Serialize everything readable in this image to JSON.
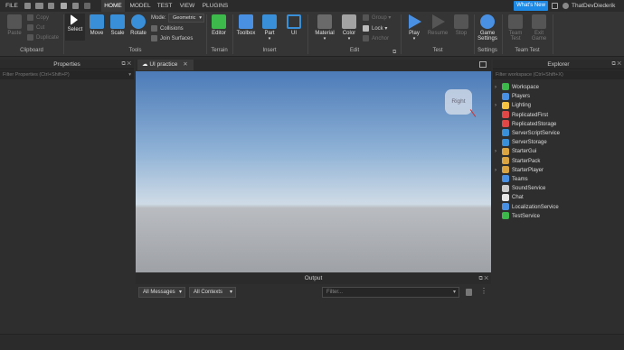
{
  "menu": {
    "file": "FILE",
    "tabs": [
      "HOME",
      "MODEL",
      "TEST",
      "VIEW",
      "PLUGINS"
    ],
    "active_tab": "HOME",
    "whats_new": "What's New",
    "username": "ThatDevDiederik"
  },
  "ribbon": {
    "clipboard": {
      "label": "Clipboard",
      "paste": "Paste",
      "copy": "Copy",
      "cut": "Cut",
      "duplicate": "Duplicate"
    },
    "tools": {
      "label": "Tools",
      "select": "Select",
      "move": "Move",
      "scale": "Scale",
      "rotate": "Rotate",
      "mode_label": "Mode:",
      "mode_value": "Geometric",
      "collisions": "Collisions",
      "join_surfaces": "Join Surfaces"
    },
    "terrain": {
      "label": "Terrain",
      "editor": "Editor"
    },
    "insert": {
      "label": "Insert",
      "toolbox": "Toolbox",
      "part": "Part",
      "ui": "UI"
    },
    "edit": {
      "label": "Edit",
      "material": "Material",
      "color": "Color",
      "group": "Group",
      "lock": "Lock",
      "anchor": "Anchor"
    },
    "test": {
      "label": "Test",
      "play": "Play",
      "resume": "Resume",
      "stop": "Stop"
    },
    "settings": {
      "label": "Settings",
      "game_settings_l1": "Game",
      "game_settings_l2": "Settings"
    },
    "team_test": {
      "label": "Team Test",
      "team_test_l1": "Team",
      "team_test_l2": "Test",
      "exit_game_l1": "Exit",
      "exit_game_l2": "Game"
    }
  },
  "properties": {
    "title": "Properties",
    "filter_placeholder": "Filter Properties (Ctrl+Shift+P)"
  },
  "viewport": {
    "tab": "UI practice",
    "viewcube_label": "Right"
  },
  "explorer": {
    "title": "Explorer",
    "filter_placeholder": "Filter workspace (Ctrl+Shift+X)",
    "items": [
      {
        "name": "Workspace",
        "expandable": true,
        "color": "#3db84a"
      },
      {
        "name": "Players",
        "expandable": false,
        "color": "#4a90e2"
      },
      {
        "name": "Lighting",
        "expandable": true,
        "color": "#f5c242"
      },
      {
        "name": "ReplicatedFirst",
        "expandable": false,
        "color": "#e04848"
      },
      {
        "name": "ReplicatedStorage",
        "expandable": false,
        "color": "#e04848"
      },
      {
        "name": "ServerScriptService",
        "expandable": false,
        "color": "#3a8fd9"
      },
      {
        "name": "ServerStorage",
        "expandable": false,
        "color": "#3a8fd9"
      },
      {
        "name": "StarterGui",
        "expandable": true,
        "color": "#d9a441"
      },
      {
        "name": "StarterPack",
        "expandable": false,
        "color": "#d9a441"
      },
      {
        "name": "StarterPlayer",
        "expandable": true,
        "color": "#d9a441"
      },
      {
        "name": "Teams",
        "expandable": false,
        "color": "#4a90e2"
      },
      {
        "name": "SoundService",
        "expandable": false,
        "color": "#cccccc"
      },
      {
        "name": "Chat",
        "expandable": false,
        "color": "#e6e6e6"
      },
      {
        "name": "LocalizationService",
        "expandable": false,
        "color": "#4a90e2"
      },
      {
        "name": "TestService",
        "expandable": false,
        "color": "#3db84a"
      }
    ]
  },
  "output": {
    "title": "Output",
    "messages_filter": "All Messages",
    "contexts_filter": "All Contexts",
    "filter_placeholder": "Filter..."
  }
}
